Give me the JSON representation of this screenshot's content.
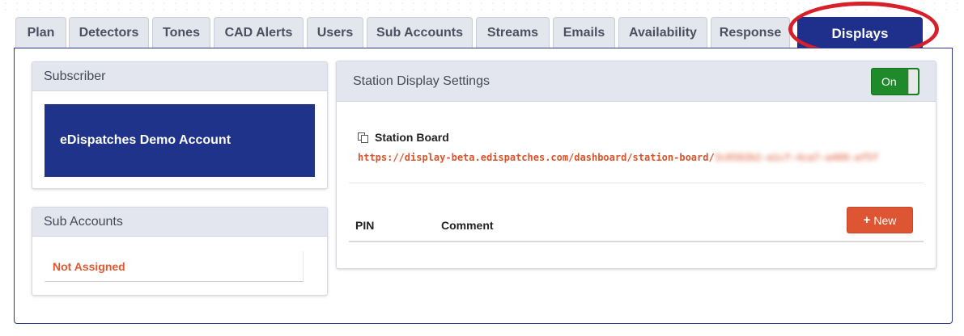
{
  "tabs": [
    {
      "label": "Plan",
      "name": "tab-plan"
    },
    {
      "label": "Detectors",
      "name": "tab-detectors"
    },
    {
      "label": "Tones",
      "name": "tab-tones"
    },
    {
      "label": "CAD Alerts",
      "name": "tab-cad-alerts"
    },
    {
      "label": "Users",
      "name": "tab-users"
    },
    {
      "label": "Sub Accounts",
      "name": "tab-sub-accounts"
    },
    {
      "label": "Streams",
      "name": "tab-streams"
    },
    {
      "label": "Emails",
      "name": "tab-emails"
    },
    {
      "label": "Availability",
      "name": "tab-availability"
    },
    {
      "label": "Response",
      "name": "tab-response"
    },
    {
      "label": "Displays",
      "name": "tab-displays",
      "active": true
    }
  ],
  "subscriber": {
    "header": "Subscriber",
    "account_name": "eDispatches Demo Account"
  },
  "sub_accounts": {
    "header": "Sub Accounts",
    "items": [
      "Not Assigned"
    ]
  },
  "station_display": {
    "header": "Station Display Settings",
    "toggle_label": "On",
    "toggle_on": true,
    "board_title": "Station Board",
    "url_visible": "https://display-beta.edispatches.com/dashboard/station-board/",
    "url_redacted": "3c0502b2-a1cf-4ca7-a400-af5f",
    "table_headers": {
      "pin": "PIN",
      "comment": "Comment"
    },
    "new_button_label": "New",
    "new_button_icon": "plus-icon"
  },
  "colors": {
    "active_tab": "#1e2f8c",
    "toggle_on": "#1f8a2a",
    "accent_orange": "#dd5533",
    "highlight_ring": "#d8202a"
  }
}
